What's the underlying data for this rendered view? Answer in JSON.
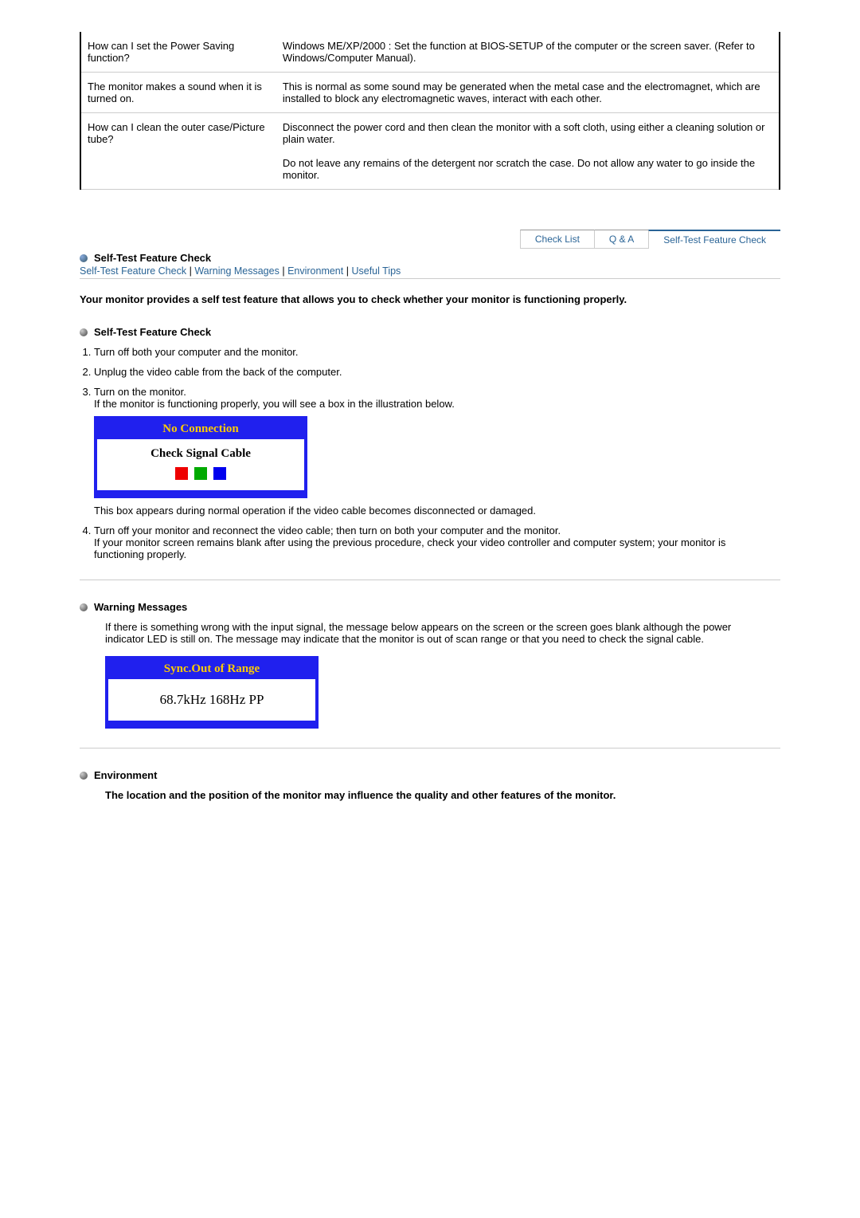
{
  "qa_table": [
    {
      "q": "How can I set the Power Saving function?",
      "a": "Windows ME/XP/2000 : Set the function at BIOS-SETUP of the computer or the screen saver. (Refer to Windows/Computer Manual)."
    },
    {
      "q": "The monitor makes a sound when it is turned on.",
      "a": "This is normal as some sound may be generated when the metal case and the electromagnet, which are installed to block any electromagnetic waves, interact with each other."
    },
    {
      "q": "How can I clean the outer case/Picture tube?",
      "a": "Disconnect the power cord and then clean the monitor with a soft cloth, using either a cleaning solution or plain water.\n\nDo not leave any remains of the detergent nor scratch the case. Do not allow any water to go inside the monitor."
    }
  ],
  "tabs": {
    "check_list": "Check List",
    "qa": "Q & A",
    "self_test": "Self-Test Feature Check"
  },
  "section_title": "Self-Test Feature Check",
  "sublinks": {
    "selftest": "Self-Test Feature Check",
    "warning": "Warning Messages",
    "environment": "Environment",
    "useful": "Useful Tips"
  },
  "intro": "Your monitor provides a self test feature that allows you to check whether your monitor is functioning properly.",
  "selftest_heading": "Self-Test Feature Check",
  "steps": {
    "s1": "Turn off both your computer and the monitor.",
    "s2": "Unplug the video cable from the back of the computer.",
    "s3a": "Turn on the monitor.",
    "s3b": "If the monitor is functioning properly, you will see a box in the illustration below.",
    "s3_after": "This box appears during normal operation if the video cable becomes disconnected or damaged.",
    "s4a": "Turn off your monitor and reconnect the video cable; then turn on both your computer and the monitor.",
    "s4b": "If your monitor screen remains blank after using the previous procedure, check your video controller and computer system; your monitor is functioning properly."
  },
  "osd1": {
    "title": "No Connection",
    "text": "Check Signal Cable"
  },
  "warning_heading": "Warning Messages",
  "warning_text": "If there is something wrong with the input signal, the message below appears on the screen or the screen goes blank although the power indicator LED is still on. The message may indicate that the monitor is out of scan range or that you need to check the signal cable.",
  "osd2": {
    "title": "Sync.Out of Range",
    "text": "68.7kHz 168Hz PP"
  },
  "env_heading": "Environment",
  "env_text": "The location and the position of the monitor may influence the quality and other features of the monitor."
}
